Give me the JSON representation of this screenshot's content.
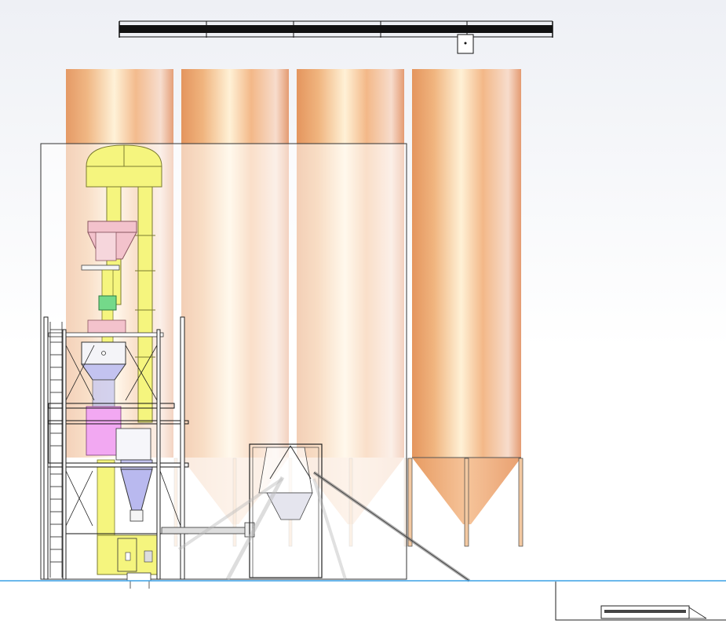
{
  "view": {
    "background_top": "#eef0f5",
    "background_bottom": "#ffffff",
    "ground_line_color": "#3aa0e6"
  },
  "colors": {
    "silo": "#e8a57a",
    "silo_highlight": "#fff3dd",
    "frame": "#222222",
    "elevator": "#f4f47a",
    "hopper_blue": "#b9b9f2",
    "hopper_pink": "#f0b8c6",
    "green_part": "#6fd884",
    "magenta_part": "#f0a0f0"
  },
  "components": {
    "silos_count": 4,
    "top_conveyor_segments": 5
  }
}
